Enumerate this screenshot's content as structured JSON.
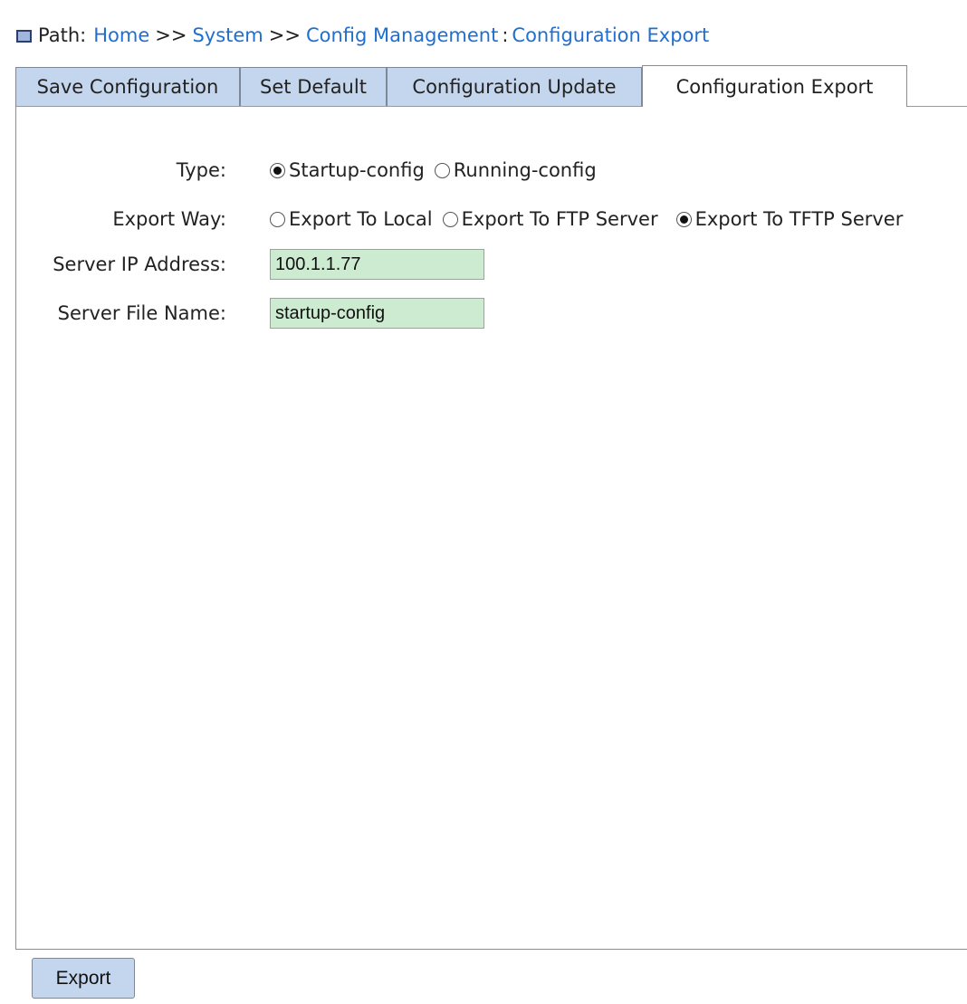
{
  "breadcrumb": {
    "label": "Path:",
    "home": "Home",
    "sep1": ">>",
    "system": "System",
    "sep2": ">>",
    "config_mgmt": "Config Management",
    "colon": ":",
    "current": "Configuration Export"
  },
  "tabs": [
    {
      "label": "Save Configuration",
      "active": false
    },
    {
      "label": "Set Default",
      "active": false
    },
    {
      "label": "Configuration Update",
      "active": false
    },
    {
      "label": "Configuration Export",
      "active": true
    }
  ],
  "form": {
    "type": {
      "label": "Type:",
      "options": [
        {
          "label": "Startup-config",
          "checked": true
        },
        {
          "label": "Running-config",
          "checked": false
        }
      ]
    },
    "export_way": {
      "label": "Export Way:",
      "options": [
        {
          "label": "Export To Local",
          "checked": false
        },
        {
          "label": "Export To FTP Server",
          "checked": false
        },
        {
          "label": "Export To TFTP Server",
          "checked": true
        }
      ]
    },
    "server_ip": {
      "label": "Server IP Address:",
      "value": "100.1.1.77"
    },
    "server_file": {
      "label": "Server File Name:",
      "value": "startup-config"
    }
  },
  "buttons": {
    "export_label": "Export"
  },
  "colors": {
    "tab_bg": "#c4d6ee",
    "link": "#1f6fd1",
    "input_bg": "#cdebd0"
  },
  "icons": {
    "breadcrumb": "window-icon"
  }
}
